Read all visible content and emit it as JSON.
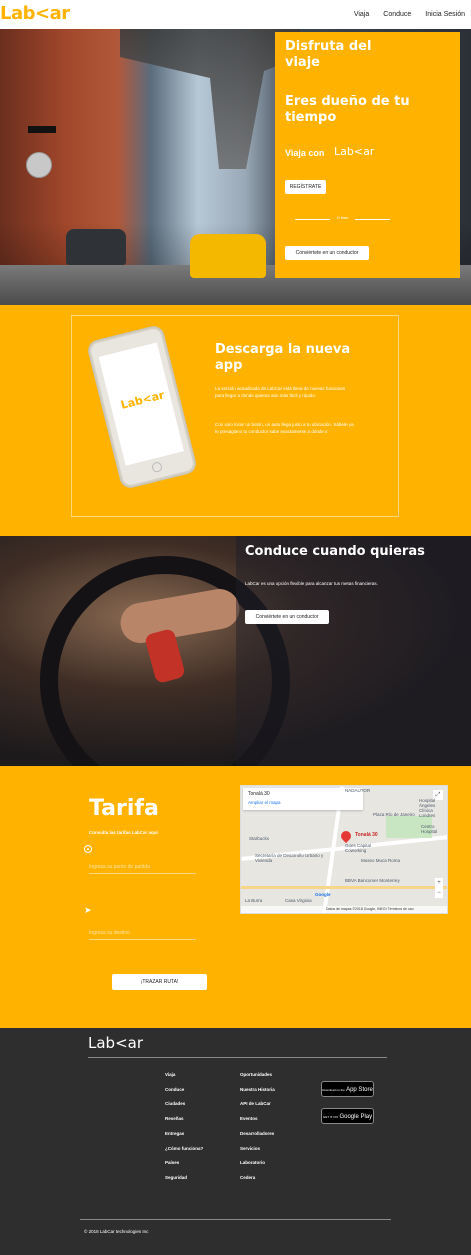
{
  "nav": {
    "logo": "Lab<ar",
    "links": [
      "Viaja",
      "Conduce",
      "Inicia Sesión"
    ]
  },
  "hero": {
    "heading1": "Disfruta del viaje",
    "heading2": "Eres dueño de tu tiempo",
    "viaja_con": "Viaja con",
    "viaja_logo": "Lab<ar",
    "register_button": "REGÍSTRATE",
    "or_text": "O bien",
    "driver_button": "Conviértete en un conductor"
  },
  "download": {
    "phone_logo": "Lab<ar",
    "title": "Descarga la nueva app",
    "para1": "La versión actualizada de LabCar está llena de nuevas funciones para llegar a donde quieras aún más fácil y rápido.",
    "para2": "Con solo tocar un botón, un auto llega justo a tu ubicación. Sábete ya te presagiano tu conductor sabe exactamente a dónde ir."
  },
  "drive": {
    "title": "Conduce cuando quieras",
    "text": "LabCar es una opción flexible para alcanzar tus metas financieras.",
    "button": "Conviértete en un conductor"
  },
  "tarifa": {
    "title": "Tarifa",
    "subtitle": "Consulta las tarifas LabCar aquí",
    "origin_placeholder": "Ingresa su punto de partida",
    "destination_placeholder": "Ingresa su destino",
    "route_button": "¡TRAZAR RUTA!",
    "map": {
      "place": "Tonalá 30",
      "enlarge": "Ampliar el mapa",
      "pin_label": "Tonalá 30",
      "labels": [
        "Plaza Río de Janeiro",
        "Museo Muca Roma",
        "Starbucks",
        "Secretaría de Desarrollo Urbano y Vivienda",
        "BBVA Bancomer Monterrey",
        "Hospital Ángeles Clínica Londres",
        "Casa Virginia",
        "Goes Capital Coworking",
        "La Burra",
        "NADAUTOR",
        "Centro Hospital"
      ],
      "attribution": "Datos de mapas ©2018 Google, INEGI",
      "terms": "Términos de uso",
      "google": "Google",
      "zoom_in": "+",
      "zoom_out": "−",
      "fullscreen": "⤢"
    }
  },
  "footer": {
    "logo": "Lab<ar",
    "col1": [
      "Viaja",
      "Conduce",
      "Ciudades",
      "Reseñas",
      "Entregas",
      "¿Cómo funciona?",
      "Países",
      "Seguridad"
    ],
    "col2": [
      "Oportunidades",
      "Nuestra Historia",
      "API de LabCar",
      "Eventos",
      "Desarrolladores",
      "Servicios",
      "Laboratorio",
      "Cedera"
    ],
    "app_store_small": "Download on the",
    "app_store": "App Store",
    "google_play_small": "GET IT ON",
    "google_play": "Google Play",
    "copyright": "© 2018 LabCar technologies Inc"
  },
  "colors": {
    "brand": "#ffb300",
    "footer_bg": "#2e2e2e"
  }
}
